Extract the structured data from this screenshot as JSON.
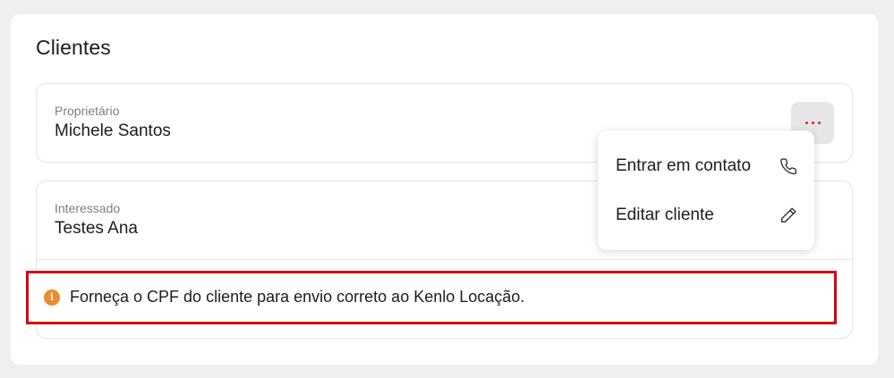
{
  "section": {
    "title": "Clientes"
  },
  "owner": {
    "role": "Proprietário",
    "name": "Michele Santos",
    "more_icon": "more-horizontal-icon",
    "more_color": "#e3232d"
  },
  "interested": {
    "role": "Interessado",
    "name": "Testes Ana"
  },
  "alert": {
    "icon": "info-icon",
    "icon_glyph": "i",
    "message": "Forneça o CPF do cliente para envio correto ao Kenlo Locação.",
    "border_color": "#d7000f",
    "icon_color": "#ef8a2e"
  },
  "menu": {
    "items": [
      {
        "label": "Entrar em contato",
        "icon": "phone-icon"
      },
      {
        "label": "Editar cliente",
        "icon": "pencil-icon"
      }
    ]
  }
}
